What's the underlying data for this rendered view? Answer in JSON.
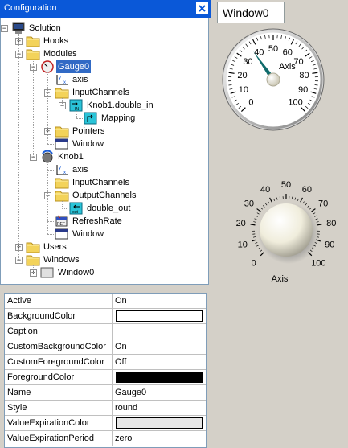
{
  "panel": {
    "title": "Configuration"
  },
  "tree": [
    {
      "label": "Solution",
      "depth": 0,
      "icon": "computer-icon",
      "exp": "-"
    },
    {
      "label": "Hooks",
      "depth": 1,
      "icon": "folder-icon",
      "exp": "+"
    },
    {
      "label": "Modules",
      "depth": 1,
      "icon": "folder-icon",
      "exp": "-"
    },
    {
      "label": "Gauge0",
      "depth": 2,
      "icon": "gauge-icon",
      "exp": "-",
      "selected": true
    },
    {
      "label": "axis",
      "depth": 3,
      "icon": "axis-icon",
      "exp": ""
    },
    {
      "label": "InputChannels",
      "depth": 3,
      "icon": "folder-icon",
      "exp": "-"
    },
    {
      "label": "Knob1.double_in",
      "depth": 4,
      "icon": "input-channel-icon",
      "exp": "-"
    },
    {
      "label": "Mapping",
      "depth": 5,
      "icon": "mapping-icon",
      "exp": ""
    },
    {
      "label": "Pointers",
      "depth": 3,
      "icon": "folder-icon",
      "exp": "+"
    },
    {
      "label": "Window",
      "depth": 3,
      "icon": "window-icon",
      "exp": ""
    },
    {
      "label": "Knob1",
      "depth": 2,
      "icon": "knob-icon",
      "exp": "-"
    },
    {
      "label": "axis",
      "depth": 3,
      "icon": "axis-icon",
      "exp": ""
    },
    {
      "label": "InputChannels",
      "depth": 3,
      "icon": "folder-icon",
      "exp": ""
    },
    {
      "label": "OutputChannels",
      "depth": 3,
      "icon": "folder-icon",
      "exp": "-"
    },
    {
      "label": "double_out",
      "depth": 4,
      "icon": "output-channel-icon",
      "exp": ""
    },
    {
      "label": "RefreshRate",
      "depth": 3,
      "icon": "refresh-rate-icon",
      "exp": ""
    },
    {
      "label": "Window",
      "depth": 3,
      "icon": "window-icon",
      "exp": ""
    },
    {
      "label": "Users",
      "depth": 1,
      "icon": "folder-icon",
      "exp": "+"
    },
    {
      "label": "Windows",
      "depth": 1,
      "icon": "folder-icon",
      "exp": "-"
    },
    {
      "label": "Window0",
      "depth": 2,
      "icon": "window-blank-icon",
      "exp": "+"
    }
  ],
  "properties": [
    {
      "name": "Active",
      "value": "On"
    },
    {
      "name": "BackgroundColor",
      "value": "",
      "swatch": "#ffffff"
    },
    {
      "name": "Caption",
      "value": ""
    },
    {
      "name": "CustomBackgroundColor",
      "value": "On"
    },
    {
      "name": "CustomForegroundColor",
      "value": "Off"
    },
    {
      "name": "ForegroundColor",
      "value": "",
      "swatch": "#000000"
    },
    {
      "name": "Name",
      "value": "Gauge0"
    },
    {
      "name": "Style",
      "value": "round"
    },
    {
      "name": "ValueExpirationColor",
      "value": "",
      "swatch": "#e6e6e6"
    },
    {
      "name": "ValueExpirationPeriod",
      "value": "zero"
    }
  ],
  "window_tab": {
    "label": "Window0"
  },
  "gauge": {
    "axis_label": "Axis",
    "ticks": [
      "0",
      "10",
      "20",
      "30",
      "40",
      "50",
      "60",
      "70",
      "80",
      "90",
      "100"
    ],
    "value": 37,
    "needle_color": "#0f6b6b"
  },
  "knob": {
    "axis_label": "Axis",
    "ticks": [
      "0",
      "10",
      "20",
      "30",
      "40",
      "50",
      "60",
      "70",
      "80",
      "90",
      "100"
    ]
  },
  "colors": {
    "title_bar": "#0a58d8",
    "selection": "#316ac5"
  }
}
